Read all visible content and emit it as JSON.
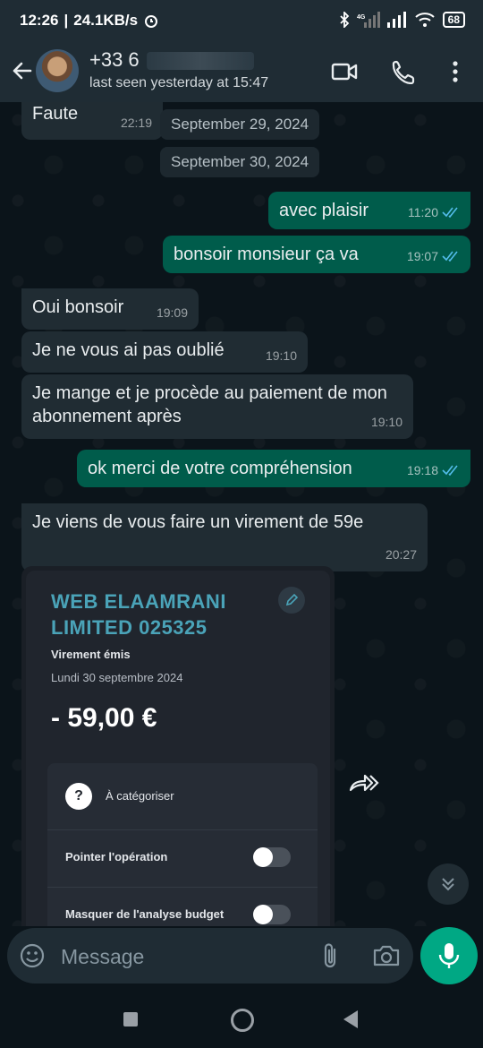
{
  "status_bar": {
    "time": "12:26",
    "separator": "|",
    "speed": "24.1KB/s",
    "battery": "68"
  },
  "header": {
    "contact_name": "+33 6",
    "last_seen": "last seen yesterday at 15:47"
  },
  "chat": {
    "date_separators": [
      "September 29, 2024",
      "September 30, 2024"
    ],
    "messages": [
      {
        "dir": "in",
        "text": "Faute",
        "time": "22:19"
      },
      {
        "dir": "out",
        "text": "avec plaisir",
        "time": "11:20",
        "status": "read"
      },
      {
        "dir": "out",
        "text": "bonsoir monsieur ça va",
        "time": "19:07",
        "status": "read"
      },
      {
        "dir": "in",
        "text": "Oui bonsoir",
        "time": "19:09"
      },
      {
        "dir": "in",
        "text": "Je ne vous ai pas oublié",
        "time": "19:10"
      },
      {
        "dir": "in",
        "text": "Je mange et je procède au paiement de mon abonnement après",
        "time": "19:10"
      },
      {
        "dir": "out",
        "text": "ok merci de votre compréhension",
        "time": "19:18",
        "status": "read"
      },
      {
        "dir": "in",
        "text": "Je viens de vous faire un virement de 59e",
        "time": "20:27"
      }
    ],
    "image_card": {
      "title_line1": "WEB ELAAMRANI",
      "title_line2": "LIMITED 025325",
      "subtitle": "Virement émis",
      "date": "Lundi 30 septembre 2024",
      "amount": "- 59,00 €",
      "category_label": "À catégoriser",
      "toggle1_label": "Pointer l'opération",
      "toggle2_label": "Masquer de l'analyse budget"
    }
  },
  "input": {
    "placeholder": "Message"
  },
  "colors": {
    "incoming_bubble": "#202c33",
    "outgoing_bubble": "#005c4b",
    "accent": "#00a884",
    "read_tick": "#53bdeb",
    "card_title": "#4aa3b8"
  },
  "icons": [
    "back-arrow-icon",
    "video-call-icon",
    "voice-call-icon",
    "more-options-icon",
    "emoji-icon",
    "attach-icon",
    "camera-icon",
    "mic-icon",
    "forward-icon",
    "scroll-down-icon",
    "edit-pencil-icon",
    "question-icon"
  ]
}
